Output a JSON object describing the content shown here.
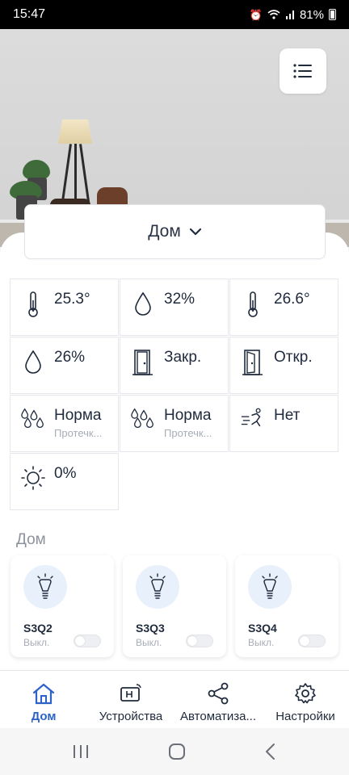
{
  "status_bar": {
    "time": "15:47",
    "battery": "81%"
  },
  "home_selector": {
    "label": "Дом"
  },
  "sensors": [
    {
      "icon": "thermometer-icon",
      "value": "25.3°",
      "sub": ""
    },
    {
      "icon": "humidity-drop-icon",
      "value": "32%",
      "sub": ""
    },
    {
      "icon": "thermometer-icon",
      "value": "26.6°",
      "sub": ""
    },
    {
      "icon": "humidity-drop-icon",
      "value": "26%",
      "sub": ""
    },
    {
      "icon": "door-closed-icon",
      "value": "Закр.",
      "sub": ""
    },
    {
      "icon": "door-open-icon",
      "value": "Откр.",
      "sub": ""
    },
    {
      "icon": "water-leak-icon",
      "value": "Норма",
      "sub": "Протечк..."
    },
    {
      "icon": "water-leak-icon",
      "value": "Норма",
      "sub": "Протечк..."
    },
    {
      "icon": "motion-icon",
      "value": "Нет",
      "sub": ""
    },
    {
      "icon": "sun-icon",
      "value": "0%",
      "sub": ""
    }
  ],
  "section": {
    "title": "Дом"
  },
  "devices": [
    {
      "name": "S3Q2",
      "state": "Выкл."
    },
    {
      "name": "S3Q3",
      "state": "Выкл."
    },
    {
      "name": "S3Q4",
      "state": "Выкл."
    }
  ],
  "nav": [
    {
      "label": "Дом",
      "active": true
    },
    {
      "label": "Устройства",
      "active": false
    },
    {
      "label": "Автоматиза...",
      "active": false
    },
    {
      "label": "Настройки",
      "active": false
    }
  ],
  "colors": {
    "accent": "#2d63c8",
    "text": "#1f2a3c",
    "muted": "#a7acb6"
  }
}
